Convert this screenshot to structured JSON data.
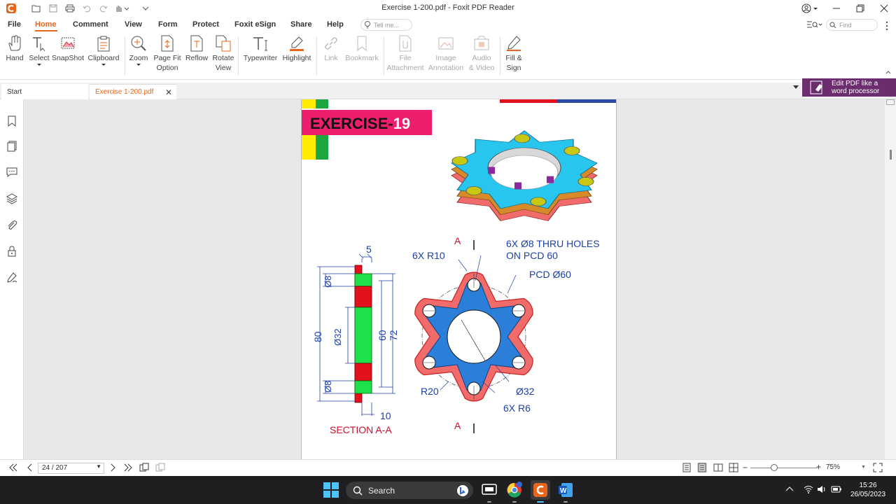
{
  "window": {
    "title": "Exercise 1-200.pdf - Foxit PDF Reader"
  },
  "menu": {
    "file": "File",
    "home": "Home",
    "comment": "Comment",
    "view": "View",
    "form": "Form",
    "protect": "Protect",
    "esign": "Foxit eSign",
    "share": "Share",
    "help": "Help",
    "tell_me": "Tell me...",
    "find": "Find"
  },
  "ribbon": {
    "hand": "Hand",
    "select": "Select",
    "snapshot": "SnapShot",
    "clipboard": "Clipboard",
    "zoom": "Zoom",
    "page_fit_1": "Page Fit",
    "page_fit_2": "Option",
    "reflow": "Reflow",
    "rotate_1": "Rotate",
    "rotate_2": "View",
    "typewriter": "Typewriter",
    "highlight": "Highlight",
    "link": "Link",
    "bookmark": "Bookmark",
    "file_att_1": "File",
    "file_att_2": "Attachment",
    "image_ann_1": "Image",
    "image_ann_2": "Annotation",
    "audio_1": "Audio",
    "audio_2": "& Video",
    "fill_1": "Fill &",
    "fill_2": "Sign"
  },
  "tabs": {
    "start": "Start",
    "doc": "Exercise 1-200.pdf"
  },
  "ad": {
    "line1": "Edit PDF like a",
    "line2": "word processor"
  },
  "drawing": {
    "title_prefix": "EXERCISE-",
    "title_number": "19",
    "holes_1": "6X Ø8 THRU HOLES",
    "holes_2": "ON PCD 60",
    "r10": "6X R10",
    "pcd": "PCD Ø60",
    "r20": "R20",
    "d32": "Ø32",
    "r6": "6X R6",
    "cut_a": "A",
    "section": "SECTION A-A",
    "dim_5": "5",
    "dim_10": "10",
    "dim_80": "80",
    "dim_60": "60",
    "dim_72": "72",
    "dim_d8": "Ø8",
    "dim_d32": "Ø32"
  },
  "status": {
    "page": "24 / 207",
    "zoom": "75%"
  },
  "taskbar": {
    "search": "Search",
    "time": "15:26",
    "date": "26/05/2023"
  },
  "colors": {
    "accent": "#e8661c",
    "ad_bg": "#6b2d6e",
    "drawing_blue": "#1c3fa8",
    "drawing_red": "#c8102e"
  }
}
